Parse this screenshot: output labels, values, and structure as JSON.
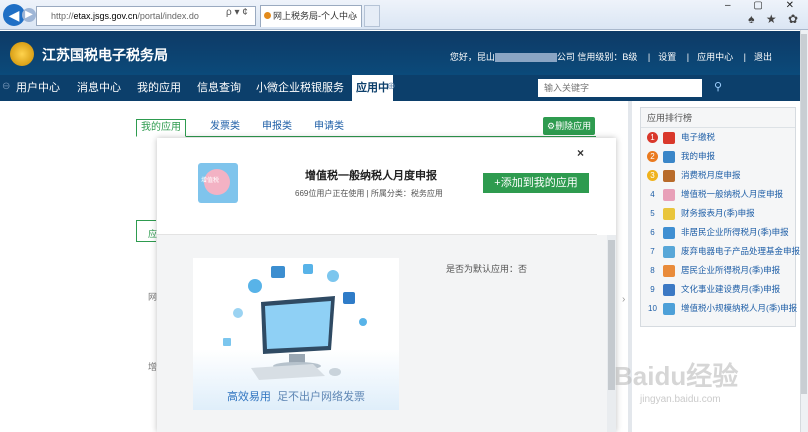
{
  "browser": {
    "address_prefix": "http://",
    "address_host": "etax.jsgs.gov.cn",
    "address_path": "/portal/index.do",
    "address_tools": "ρ ▾ ¢",
    "tab_title": "网上税务局-个人中心",
    "tab_close": "×",
    "window_controls": "‒ ▢ ✕",
    "toolbar_icons": "♠ ★ ✿"
  },
  "header": {
    "site_title": "江苏国税电子税务局",
    "greeting": "您好，昆山",
    "company_suffix": "公司 信用级别：B级",
    "links": [
      "设置",
      "应用中心",
      "退出"
    ]
  },
  "nav": {
    "items": [
      "用户中心",
      "消息中心",
      "我的应用",
      "信息查询",
      "小微企业税银服务"
    ],
    "active": "应用中",
    "search_placeholder": "输入关键字"
  },
  "tabs": {
    "items": [
      "我的应用",
      "发票类",
      "申报类",
      "申请类"
    ],
    "delete_button": "删除应用"
  },
  "background_text": {
    "left_marker": "应",
    "row1": "网",
    "row2": "增"
  },
  "modal": {
    "close": "×",
    "app_icon_label": "增值税",
    "title": "增值税一般纳税人月度申报",
    "meta": "669位用户正在使用 | 所属分类：税务应用",
    "add_button": "+添加到我的应用",
    "default_app_label": "是否为默认应用：否",
    "banner_caption_1": "高效易用",
    "banner_caption_2": "足不出户网络发票"
  },
  "ranking": {
    "title": "应用排行榜",
    "items": [
      {
        "num": "1",
        "name": "电子缴税",
        "badge": "#d9382b",
        "icon": "#d9382b"
      },
      {
        "num": "2",
        "name": "我的申报",
        "badge": "#ea7a1f",
        "icon": "#3a86c8"
      },
      {
        "num": "3",
        "name": "消费税月度申报",
        "badge": "#f0b21c",
        "icon": "#b86b2a"
      },
      {
        "num": "4",
        "name": "增值税一般纳税人月度申报",
        "badge": "",
        "icon": "#e8a0b8"
      },
      {
        "num": "5",
        "name": "财务报表月(季)申报",
        "badge": "",
        "icon": "#e9c53c"
      },
      {
        "num": "6",
        "name": "非居民企业所得税月(季)申报",
        "badge": "",
        "icon": "#3f8fd2"
      },
      {
        "num": "7",
        "name": "废弃电器电子产品处理基金申报",
        "badge": "",
        "icon": "#58a7d8"
      },
      {
        "num": "8",
        "name": "居民企业所得税月(季)申报",
        "badge": "",
        "icon": "#e98b3a"
      },
      {
        "num": "9",
        "name": "文化事业建设费月(季)申报",
        "badge": "",
        "icon": "#3c79c4"
      },
      {
        "num": "10",
        "name": "增值税小规模纳税人月(季)申报",
        "badge": "",
        "icon": "#4da0d8"
      }
    ]
  },
  "watermark": {
    "text": "Baidu经验",
    "url": "jingyan.baidu.com"
  }
}
